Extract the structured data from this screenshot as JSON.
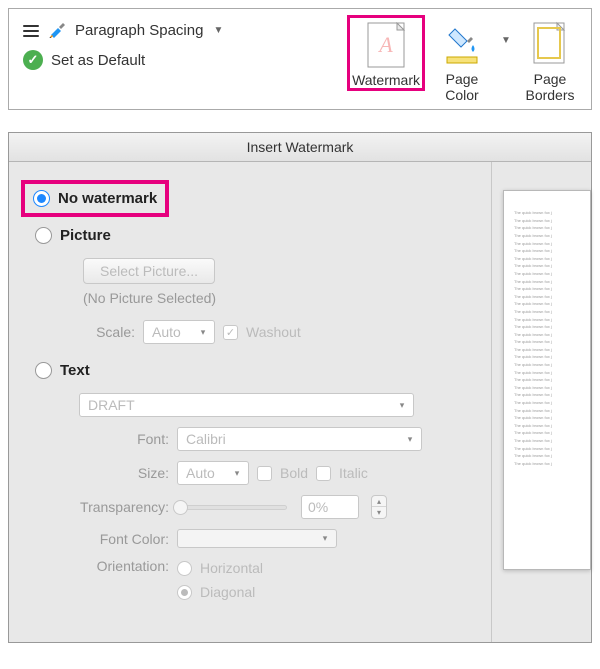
{
  "ribbon": {
    "paragraph_spacing_label": "Paragraph Spacing",
    "set_default_label": "Set as Default",
    "watermark_label": "Watermark",
    "page_color_label": "Page\nColor",
    "page_borders_label": "Page\nBorders"
  },
  "dialog": {
    "title": "Insert Watermark",
    "no_watermark_label": "No watermark",
    "picture": {
      "label": "Picture",
      "select_button": "Select Picture...",
      "status": "(No Picture Selected)",
      "scale_label": "Scale:",
      "scale_value": "Auto",
      "washout_label": "Washout"
    },
    "text": {
      "label": "Text",
      "text_value": "DRAFT",
      "font_label": "Font:",
      "font_value": "Calibri",
      "size_label": "Size:",
      "size_value": "Auto",
      "bold_label": "Bold",
      "italic_label": "Italic",
      "transparency_label": "Transparency:",
      "transparency_value": "0%",
      "font_color_label": "Font Color:",
      "orientation_label": "Orientation:",
      "orientation_horizontal": "Horizontal",
      "orientation_diagonal": "Diagonal"
    },
    "preview_line": "The quick brown fox j"
  }
}
